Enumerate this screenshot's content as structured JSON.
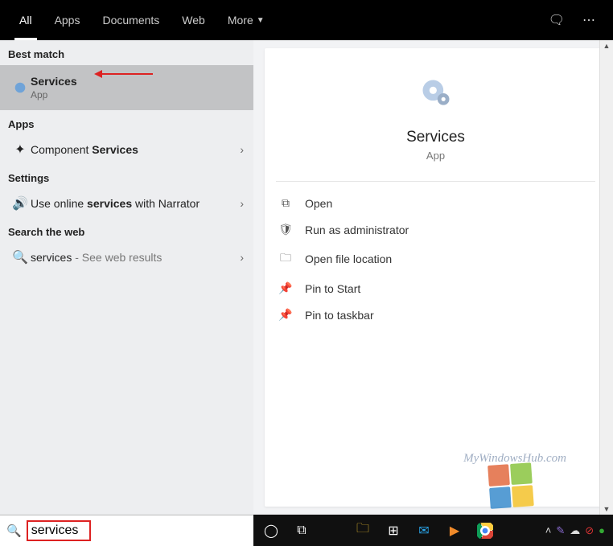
{
  "tabs": {
    "all": "All",
    "apps": "Apps",
    "documents": "Documents",
    "web": "Web",
    "more": "More"
  },
  "left": {
    "best_match_header": "Best match",
    "best_match_title": "Services",
    "best_match_type": "App",
    "apps_header": "Apps",
    "component_prefix": "Component ",
    "component_bold": "Services",
    "settings_header": "Settings",
    "narrator_prefix": "Use online ",
    "narrator_bold": "services",
    "narrator_suffix": " with Narrator",
    "web_header": "Search the web",
    "web_term": "services",
    "web_suffix": " - See web results"
  },
  "details": {
    "title": "Services",
    "type": "App",
    "actions": {
      "open": "Open",
      "run_admin": "Run as administrator",
      "open_loc": "Open file location",
      "pin_start": "Pin to Start",
      "pin_taskbar": "Pin to taskbar"
    }
  },
  "search": {
    "value": "services"
  },
  "watermark": "MyWindowsHub.com"
}
